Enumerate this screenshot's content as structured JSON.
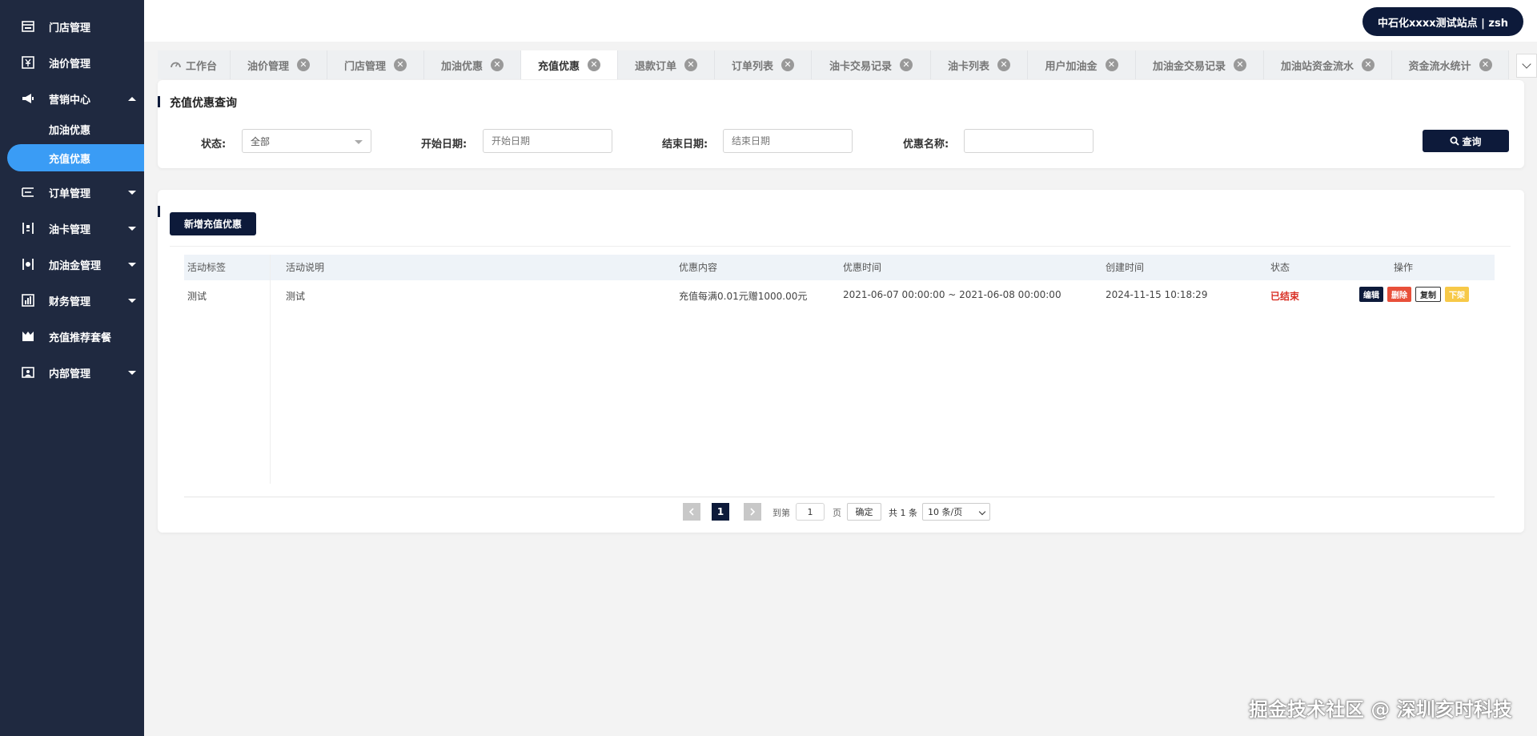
{
  "sidebar": {
    "items": [
      {
        "label": "门店管理",
        "icon": "store-icon"
      },
      {
        "label": "油价管理",
        "icon": "price-icon"
      },
      {
        "label": "营销中心",
        "icon": "marketing-icon",
        "expanded": true,
        "children": [
          {
            "label": "加油优惠"
          },
          {
            "label": "充值优惠",
            "active": true
          }
        ]
      },
      {
        "label": "订单管理",
        "icon": "order-icon"
      },
      {
        "label": "油卡管理",
        "icon": "card-icon"
      },
      {
        "label": "加油金管理",
        "icon": "fund-icon"
      },
      {
        "label": "财务管理",
        "icon": "finance-icon"
      },
      {
        "label": "充值推荐套餐",
        "icon": "package-icon"
      },
      {
        "label": "内部管理",
        "icon": "internal-icon"
      }
    ]
  },
  "header": {
    "user": "中石化xxxx测试站点 | zsh"
  },
  "tabs": [
    {
      "label": "工作台",
      "closable": false
    },
    {
      "label": "油价管理",
      "closable": true
    },
    {
      "label": "门店管理",
      "closable": true
    },
    {
      "label": "加油优惠",
      "closable": true
    },
    {
      "label": "充值优惠",
      "closable": true,
      "active": true
    },
    {
      "label": "退款订单",
      "closable": true
    },
    {
      "label": "订单列表",
      "closable": true
    },
    {
      "label": "油卡交易记录",
      "closable": true
    },
    {
      "label": "油卡列表",
      "closable": true
    },
    {
      "label": "用户加油金",
      "closable": true
    },
    {
      "label": "加油金交易记录",
      "closable": true
    },
    {
      "label": "加油站资金流水",
      "closable": true
    },
    {
      "label": "资金流水统计",
      "closable": true
    }
  ],
  "query": {
    "title": "充值优惠查询",
    "status_label": "状态:",
    "status_value": "全部",
    "start_label": "开始日期:",
    "start_placeholder": "开始日期",
    "end_label": "结束日期:",
    "end_placeholder": "结束日期",
    "name_label": "优惠名称:",
    "name_value": "",
    "search_button": "查询"
  },
  "list": {
    "add_button": "新增充值优惠",
    "columns": [
      "活动标签",
      "活动说明",
      "优惠内容",
      "优惠时间",
      "创建时间",
      "状态",
      "操作"
    ],
    "rows": [
      {
        "tag": "测试",
        "desc": "测试",
        "content": "充值每满0.01元赠1000.00元",
        "period": "2021-06-07 00:00:00 ~ 2021-06-08 00:00:00",
        "created": "2024-11-15 10:18:29",
        "status": "已结束",
        "actions": [
          "编辑",
          "删除",
          "复制",
          "下架"
        ]
      }
    ]
  },
  "pagination": {
    "current_page": "1",
    "goto_prefix": "到第",
    "goto_value": "1",
    "goto_suffix": "页",
    "confirm": "确定",
    "total": "共 1 条",
    "page_size": "10 条/页"
  },
  "watermark": "掘金技术社区 @ 深圳亥时科技",
  "colors": {
    "sidebar_bg": "#1f2940",
    "accent": "#3a9cf5",
    "dark_button": "#0d1a3a",
    "danger": "#e8503a",
    "warning": "#f7c948",
    "status_ended": "#d93025"
  }
}
